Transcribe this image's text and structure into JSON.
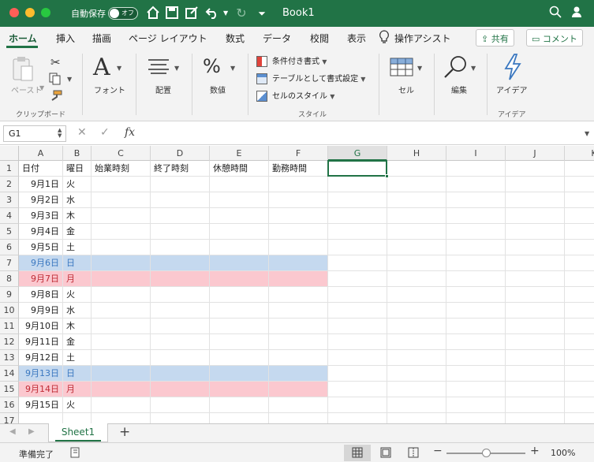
{
  "window": {
    "autosave_label": "自動保存",
    "autosave_state": "オフ",
    "title": "Book1",
    "colors": {
      "theme_green": "#217346",
      "sunday_fill": "#c5d9ef",
      "saturday_fill": "#fbc8cf"
    }
  },
  "ribbon_tabs": [
    "ホーム",
    "挿入",
    "描画",
    "ページ レイアウト",
    "数式",
    "データ",
    "校閲",
    "表示",
    "操作アシスト"
  ],
  "top_buttons": {
    "share": "共有",
    "comment": "コメント"
  },
  "ribbon": {
    "paste": "ペースト",
    "clipboard_group": "クリップボード",
    "font": "フォント",
    "alignment": "配置",
    "number": "数値",
    "style_items": [
      "条件付き書式",
      "テーブルとして書式設定",
      "セルのスタイル"
    ],
    "style_group": "スタイル",
    "cells": "セル",
    "editing": "編集",
    "ideas": "アイデア",
    "ideas_group": "アイデア"
  },
  "formula_bar": {
    "name_box": "G1",
    "fx": "fx",
    "formula": ""
  },
  "grid": {
    "columns": [
      "A",
      "B",
      "C",
      "D",
      "E",
      "F",
      "G",
      "H",
      "I",
      "J",
      "K"
    ],
    "selected_column": "G",
    "selected_cell": "G1",
    "header_row": [
      "日付",
      "曜日",
      "始業時刻",
      "終了時刻",
      "休憩時間",
      "勤務時間"
    ],
    "rows": [
      {
        "num": "1"
      },
      {
        "num": "2",
        "date": "9月1日",
        "day": "火",
        "type": "weekday"
      },
      {
        "num": "3",
        "date": "9月2日",
        "day": "水",
        "type": "weekday"
      },
      {
        "num": "4",
        "date": "9月3日",
        "day": "木",
        "type": "weekday"
      },
      {
        "num": "5",
        "date": "9月4日",
        "day": "金",
        "type": "weekday"
      },
      {
        "num": "6",
        "date": "9月5日",
        "day": "土",
        "type": "weekday"
      },
      {
        "num": "7",
        "date": "9月6日",
        "day": "日",
        "type": "sun"
      },
      {
        "num": "8",
        "date": "9月7日",
        "day": "月",
        "type": "sat"
      },
      {
        "num": "9",
        "date": "9月8日",
        "day": "火",
        "type": "weekday"
      },
      {
        "num": "10",
        "date": "9月9日",
        "day": "水",
        "type": "weekday"
      },
      {
        "num": "11",
        "date": "9月10日",
        "day": "木",
        "type": "weekday"
      },
      {
        "num": "12",
        "date": "9月11日",
        "day": "金",
        "type": "weekday"
      },
      {
        "num": "13",
        "date": "9月12日",
        "day": "土",
        "type": "weekday"
      },
      {
        "num": "14",
        "date": "9月13日",
        "day": "日",
        "type": "sun"
      },
      {
        "num": "15",
        "date": "9月14日",
        "day": "月",
        "type": "sat"
      },
      {
        "num": "16",
        "date": "9月15日",
        "day": "火",
        "type": "weekday"
      },
      {
        "num": "17"
      }
    ]
  },
  "sheets": {
    "active": "Sheet1",
    "add": "+"
  },
  "status": {
    "ready": "準備完了",
    "zoom": "100%",
    "zoom_value_percent": 100
  }
}
